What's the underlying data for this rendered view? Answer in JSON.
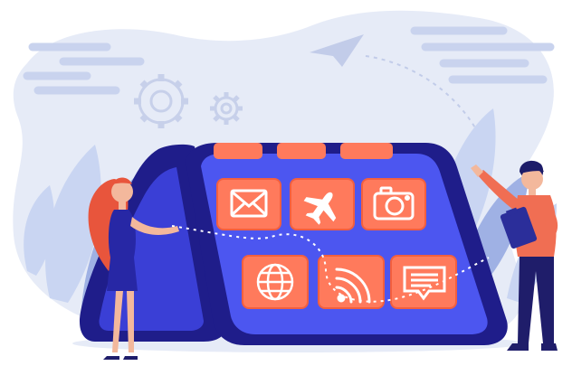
{
  "illustration": {
    "palette": {
      "backdrop": "#e6ebf7",
      "backdrop_lines": "#c9d3ee",
      "gear": "#c7d0ea",
      "leaves_light": "#c9d5f2",
      "leaves_mid": "#9fb1e4",
      "device_back": "#1f1d8a",
      "device_face": "#3a3fd6",
      "device_screen": "#4c56f0",
      "app_tile": "#ff7a5c",
      "app_tile_stroke": "#f35f3e",
      "app_glyph": "#ffffff",
      "paper_plane": "#c2cce9",
      "woman_hair": "#e8553c",
      "woman_dress": "#2727a5",
      "woman_skin": "#f3b89c",
      "man_shirt": "#f06e53",
      "man_pants": "#1f1d6a",
      "man_hair": "#1d1c69",
      "clipboard": "#2b2e9a",
      "dotted_path": "#ffffff"
    },
    "app_icons": [
      "mail-icon",
      "airplane-icon",
      "camera-icon",
      "globe-icon",
      "wifi-icon",
      "chat-icon"
    ]
  }
}
